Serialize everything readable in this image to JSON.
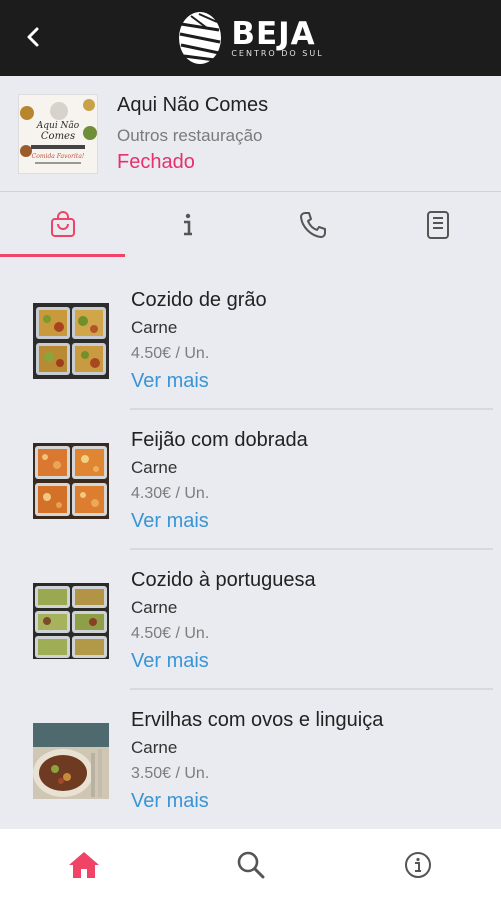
{
  "header": {
    "back_icon": "chevron-left-icon",
    "logo_title": "BEJA",
    "logo_subtitle": "CENTRO DO SUL"
  },
  "store": {
    "name": "Aqui Não Comes",
    "category": "Outros restauração",
    "status": "Fechado",
    "thumb_text_1": "Aqui Não Comes",
    "thumb_text_2": "Comida Favorita!"
  },
  "tabs": [
    {
      "icon": "shopping-bag-icon",
      "active": true
    },
    {
      "icon": "info-icon",
      "active": false
    },
    {
      "icon": "phone-icon",
      "active": false
    },
    {
      "icon": "document-icon",
      "active": false
    }
  ],
  "products": [
    {
      "title": "Cozido de grão",
      "category": "Carne",
      "price": "4.50€ / Un.",
      "more": "Ver mais"
    },
    {
      "title": "Feijão com dobrada",
      "category": "Carne",
      "price": "4.30€ / Un.",
      "more": "Ver mais"
    },
    {
      "title": "Cozido à portuguesa",
      "category": "Carne",
      "price": "4.50€ / Un.",
      "more": "Ver mais"
    },
    {
      "title": "Ervilhas com ovos e linguiça",
      "category": "Carne",
      "price": "3.50€ / Un.",
      "more": "Ver mais"
    }
  ],
  "bottom_nav": [
    {
      "icon": "home-icon",
      "active": true
    },
    {
      "icon": "search-icon",
      "active": false
    },
    {
      "icon": "info-circle-icon",
      "active": false
    }
  ],
  "colors": {
    "accent": "#f04466",
    "status_closed": "#e8306a",
    "link": "#3a95d5",
    "topbar": "#1c1c1c",
    "background": "#e9ebf1"
  }
}
